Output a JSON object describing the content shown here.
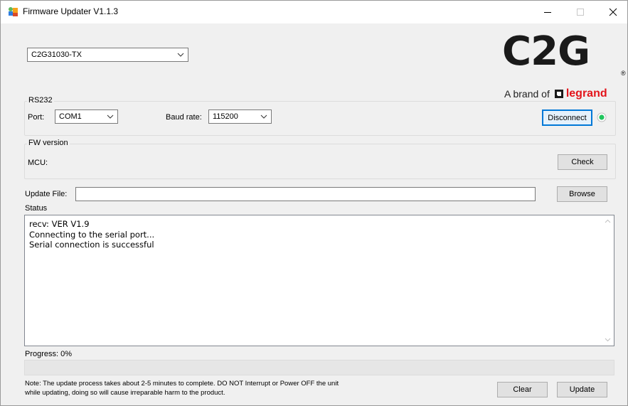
{
  "window": {
    "title": "Firmware Updater V1.1.3"
  },
  "device_select": {
    "value": "C2G31030-TX"
  },
  "logo": {
    "text": "C2G",
    "registered": "®",
    "brand_prefix": "A brand of",
    "brand_name": "legrand"
  },
  "rs232": {
    "group_label": "RS232",
    "port_label": "Port:",
    "port_value": "COM1",
    "baud_label": "Baud rate:",
    "baud_value": "115200",
    "disconnect_label": "Disconnect",
    "connection_status": "connected",
    "indicator_color": "#22c55e"
  },
  "fw_version": {
    "group_label": "FW version",
    "mcu_label": "MCU:",
    "mcu_value": "",
    "check_label": "Check"
  },
  "update_file": {
    "label": "Update File:",
    "value": "",
    "browse_label": "Browse"
  },
  "status": {
    "label": "Status",
    "lines": [
      "recv: VER V1.9",
      "Connecting to the serial port...",
      "Serial connection is successful"
    ]
  },
  "progress": {
    "label": "Progress: 0%",
    "percent": 0
  },
  "footer": {
    "note_line1": "Note: The update process takes about 2-5 minutes to complete. DO NOT Interrupt or Power OFF the unit",
    "note_line2": "while updating, doing so will cause irreparable harm to the product.",
    "clear_label": "Clear",
    "update_label": "Update"
  },
  "colors": {
    "accent": "#0078d7",
    "legrand_red": "#e3141b"
  }
}
